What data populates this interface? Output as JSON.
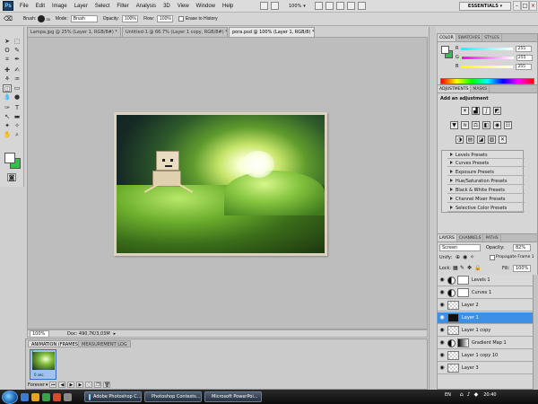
{
  "menubar": {
    "logo": "Ps",
    "items": [
      "File",
      "Edit",
      "Image",
      "Layer",
      "Select",
      "Filter",
      "Analysis",
      "3D",
      "View",
      "Window",
      "Help"
    ],
    "zoom": "100%",
    "workspace": "ESSENTIALS ▾"
  },
  "options": {
    "brush_label": "Brush:",
    "brush_size": "35",
    "mode_label": "Mode:",
    "mode_value": "Brush",
    "opacity_label": "Opacity:",
    "opacity_value": "100%",
    "flow_label": "Flow:",
    "flow_value": "100%",
    "erase_history": "Erase to History"
  },
  "documents": {
    "tabs": [
      "Lampa.jpg @ 25% (Layer 1, RGB/8#) *",
      "Untitled-1 @ 66.7% (Layer 1 copy, RGB/8#) *",
      "pora.psd @ 100% (Layer 1, RGB/8) *"
    ],
    "active_index": 2
  },
  "status": {
    "zoom": "100%",
    "doc_info": "Doc: 490,7K/3,03M"
  },
  "animation": {
    "tabs": [
      "ANIMATION (FRAMES)",
      "MEASUREMENT LOG"
    ],
    "frame_number": "1",
    "frame_duration": "0 sec.",
    "loop": "Forever"
  },
  "color_panel": {
    "tabs": [
      "COLOR",
      "SWATCHES",
      "STYLES"
    ],
    "r": "255",
    "g": "255",
    "b": "255",
    "r_label": "R",
    "g_label": "G",
    "b_label": "B"
  },
  "adjustments": {
    "tabs": [
      "ADJUSTMENTS",
      "MASKS"
    ],
    "title": "Add an adjustment",
    "presets": [
      "Levels Presets",
      "Curves Presets",
      "Exposure Presets",
      "Hue/Saturation Presets",
      "Black & White Presets",
      "Channel Mixer Presets",
      "Selective Color Presets"
    ]
  },
  "layers": {
    "tabs": [
      "LAYERS",
      "CHANNELS",
      "PATHS"
    ],
    "blend_mode": "Screen",
    "opacity_label": "Opacity:",
    "opacity": "82%",
    "unify_label": "Unify:",
    "propagate": "Propagate Frame 1",
    "lock_label": "Lock:",
    "fill_label": "Fill:",
    "fill": "100%",
    "items": [
      {
        "name": "Levels 1",
        "thumb": "adj"
      },
      {
        "name": "Curves 1",
        "thumb": "adj"
      },
      {
        "name": "Layer 2",
        "thumb": "trans"
      },
      {
        "name": "Layer 1",
        "thumb": "dark"
      },
      {
        "name": "Layer 1 copy",
        "thumb": "trans"
      },
      {
        "name": "Gradient Map 1",
        "thumb": "grad"
      },
      {
        "name": "Layer 1 copy 10",
        "thumb": "trans"
      },
      {
        "name": "Layer 3",
        "thumb": "trans"
      }
    ],
    "selected_index": 3
  },
  "taskbar": {
    "buttons": [
      "Adobe Photoshop C...",
      "Photoshop Contests...",
      "Microsoft PowerPoi..."
    ],
    "lang": "EN",
    "time": "20:40"
  },
  "colors": {
    "selection": "#3e8fe6",
    "foreground": "#ffffff",
    "background": "#2ec24a"
  }
}
